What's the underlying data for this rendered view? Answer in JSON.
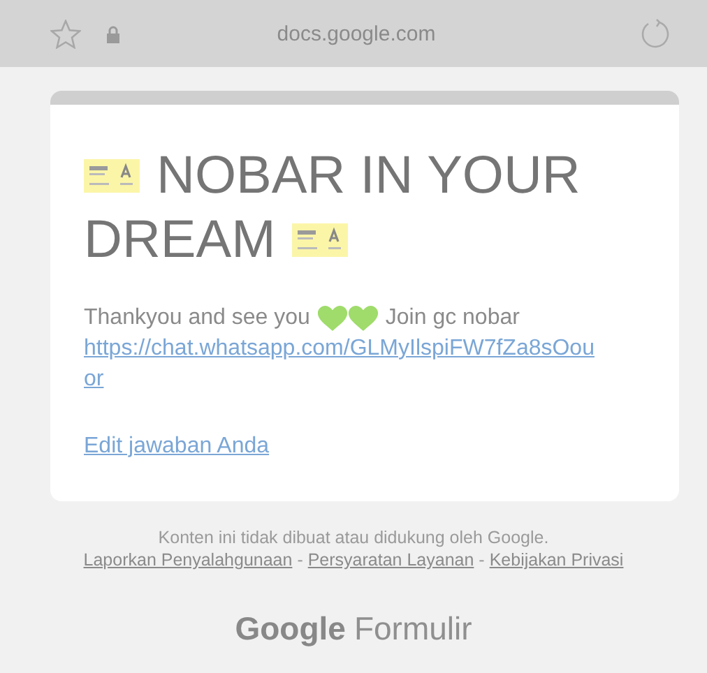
{
  "browser": {
    "address": "docs.google.com"
  },
  "form": {
    "title_lines": [
      "NOBAR IN YOUR",
      "DREAM"
    ],
    "message": {
      "before": "Thankyou and see you",
      "after": "Join gc nobar"
    },
    "link": "https://chat.whatsapp.com/GLMyIlspiFW7fZa8sOouor",
    "edit_link": "Edit jawaban Anda"
  },
  "footer": {
    "notice": "Konten ini tidak dibuat atau didukung oleh Google.",
    "links": [
      {
        "label": "Laporkan Penyalahgunaan"
      },
      {
        "label": "Persyaratan Layanan"
      },
      {
        "label": "Kebijakan Privasi"
      }
    ],
    "separator": "-",
    "brand": {
      "google": "Google",
      "product": "Formulir"
    }
  }
}
